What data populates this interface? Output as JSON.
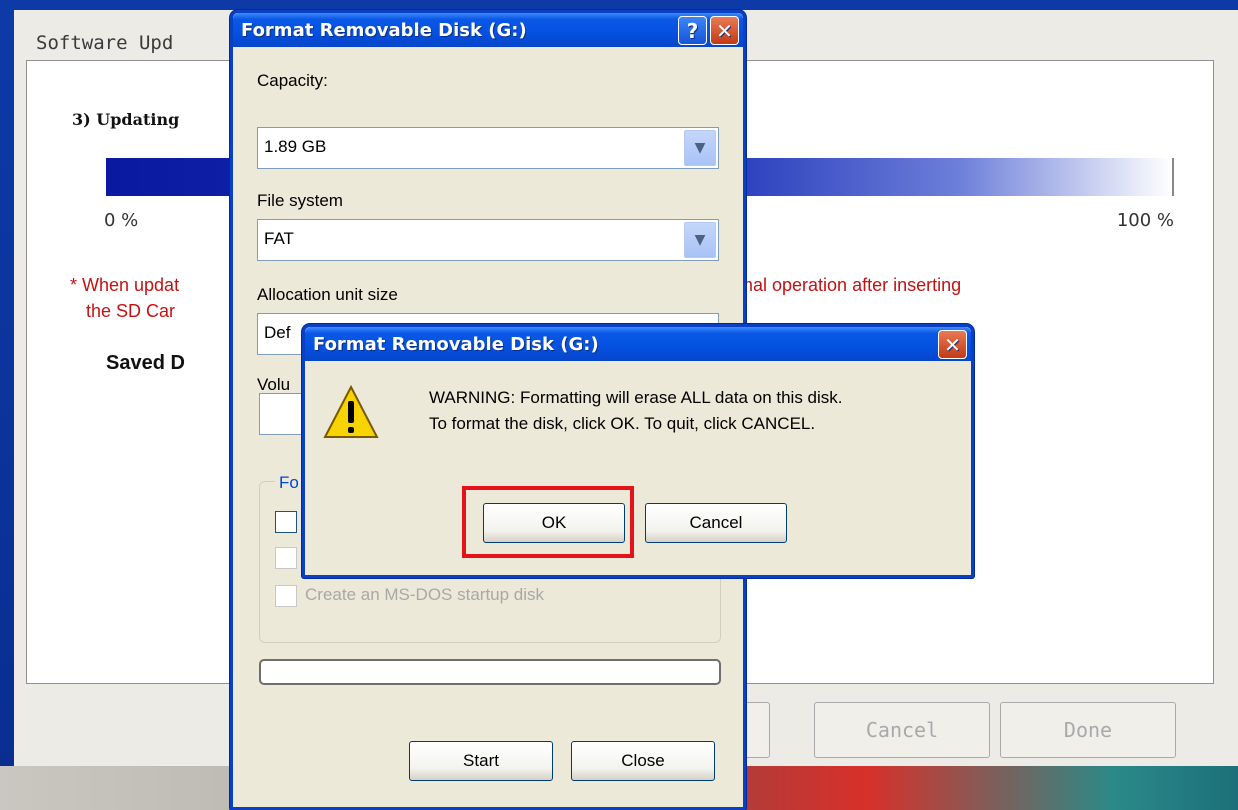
{
  "background_app": {
    "title": "Software Upd",
    "step": "3) Updating",
    "progress_start": "0 %",
    "progress_end": "100 %",
    "note_line1_start": "* When updat",
    "note_line1_end": "mal operation after inserting",
    "note_line2": "the SD Car",
    "saved": "Saved D",
    "buttons": {
      "cancel": "Cancel",
      "done": "Done"
    }
  },
  "format_dialog": {
    "title": "Format Removable Disk (G:)",
    "help_glyph": "?",
    "close_glyph": "✕",
    "capacity_label": "Capacity:",
    "capacity_value": "1.89 GB",
    "filesystem_label": "File system",
    "filesystem_value": "FAT",
    "allocation_label": "Allocation unit size",
    "allocation_value": "Def",
    "volume_label": "Volu",
    "options_group_label": "Fo",
    "msdos_label": "Create an MS-DOS startup disk",
    "start_label": "Start",
    "close_label": "Close"
  },
  "warning_dialog": {
    "title": "Format Removable Disk (G:)",
    "close_glyph": "✕",
    "icon": "warning-icon",
    "line1": "WARNING: Formatting will erase ALL data on this disk.",
    "line2": "To format the disk, click OK. To quit, click CANCEL.",
    "ok_label": "OK",
    "cancel_label": "Cancel"
  },
  "colors": {
    "xp_title_blue": "#0550e0",
    "note_red": "#c41212",
    "highlight_red": "#e5121b"
  }
}
